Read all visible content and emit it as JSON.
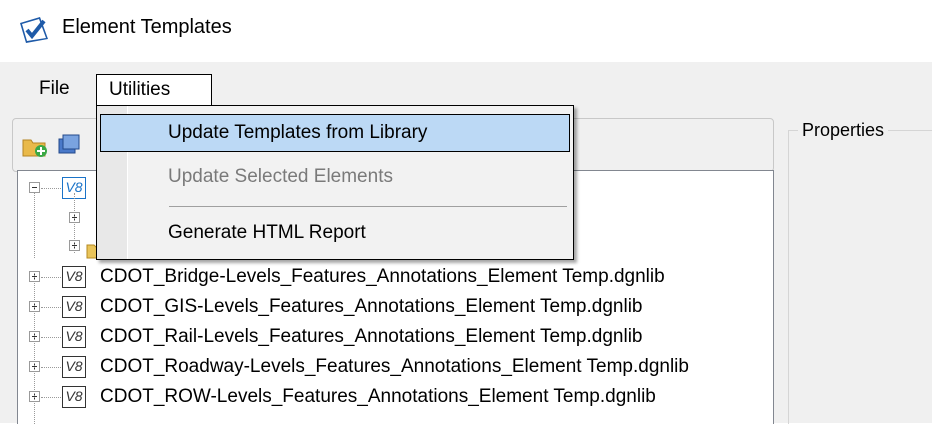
{
  "window": {
    "title": "Element Templates"
  },
  "menubar": {
    "file": "File",
    "utilities": "Utilities"
  },
  "utilities_menu": {
    "items": [
      {
        "label": "Update Templates from Library",
        "state": "highlighted"
      },
      {
        "label": "Update Selected Elements",
        "state": "disabled"
      },
      {
        "label": "Generate HTML Report",
        "state": "enabled"
      }
    ]
  },
  "properties": {
    "title": "Properties"
  },
  "tree": {
    "root_badge": "V8",
    "files": [
      {
        "badge": "V8",
        "name": "CDOT_Bridge-Levels_Features_Annotations_Element Temp.dgnlib"
      },
      {
        "badge": "V8",
        "name": "CDOT_GIS-Levels_Features_Annotations_Element Temp.dgnlib"
      },
      {
        "badge": "V8",
        "name": "CDOT_Rail-Levels_Features_Annotations_Element Temp.dgnlib"
      },
      {
        "badge": "V8",
        "name": "CDOT_Roadway-Levels_Features_Annotations_Element Temp.dgnlib"
      },
      {
        "badge": "V8",
        "name": "CDOT_ROW-Levels_Features_Annotations_Element Temp.dgnlib"
      }
    ]
  },
  "colors": {
    "highlight": "#bcd9f5",
    "disabled_text": "#7a7a7a",
    "selected_badge": "#1a73c8"
  }
}
